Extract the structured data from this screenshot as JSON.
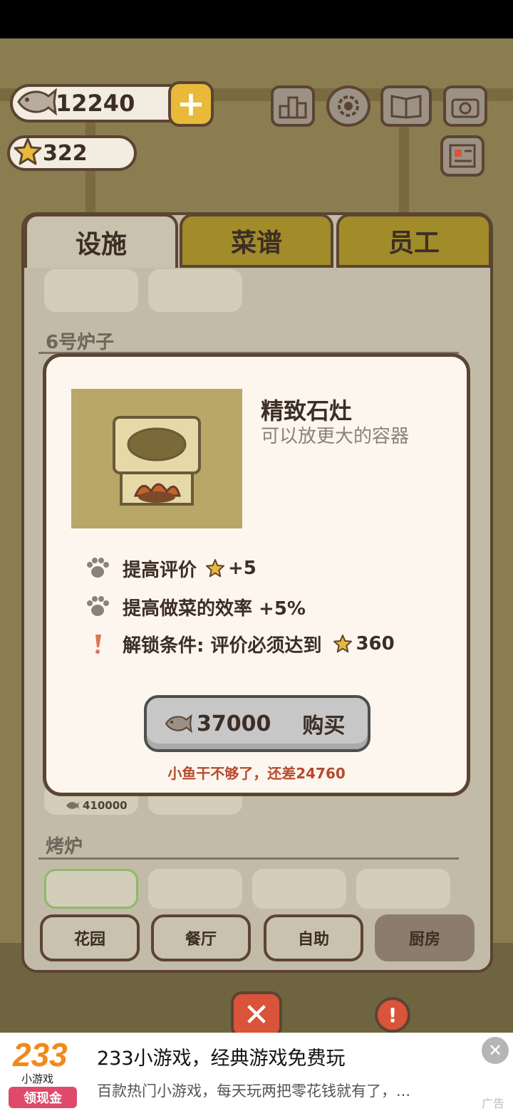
{
  "currency": {
    "fish": "12240",
    "stars": "322",
    "add_label": "+"
  },
  "tabs": [
    "设施",
    "菜谱",
    "员工"
  ],
  "sections": {
    "stove6_label": "6号炉子",
    "stove6_slot_price": "410000",
    "oven_label": "烤炉"
  },
  "modal": {
    "name": "精致石灶",
    "description": "可以放更大的容器",
    "effects": [
      {
        "text": "提高评价",
        "value": "+5"
      },
      {
        "text": "提高做菜的效率  +5%"
      },
      {
        "text": "解锁条件: 评价必须达到",
        "value": "360"
      }
    ],
    "price": "37000",
    "buy_label": "购买",
    "warning": "小鱼干不够了，还差24760"
  },
  "bottom_tabs": [
    "花园",
    "餐厅",
    "自助",
    "厨房"
  ],
  "close_label": "✕",
  "ad": {
    "logo_number": "233",
    "logo_text": "小游戏",
    "logo_pill": "领现金",
    "title": "233小游戏，经典游戏免费玩",
    "subtitle": "百款热门小游戏，每天玩两把零花钱就有了，...",
    "close": "✕",
    "tag": "广告"
  },
  "colors": {
    "accent_gold": "#e9b93a",
    "tab_inactive": "#a28c2a",
    "outline": "#5c4433",
    "warning": "#b54a2e",
    "close_red": "#d9543a"
  }
}
